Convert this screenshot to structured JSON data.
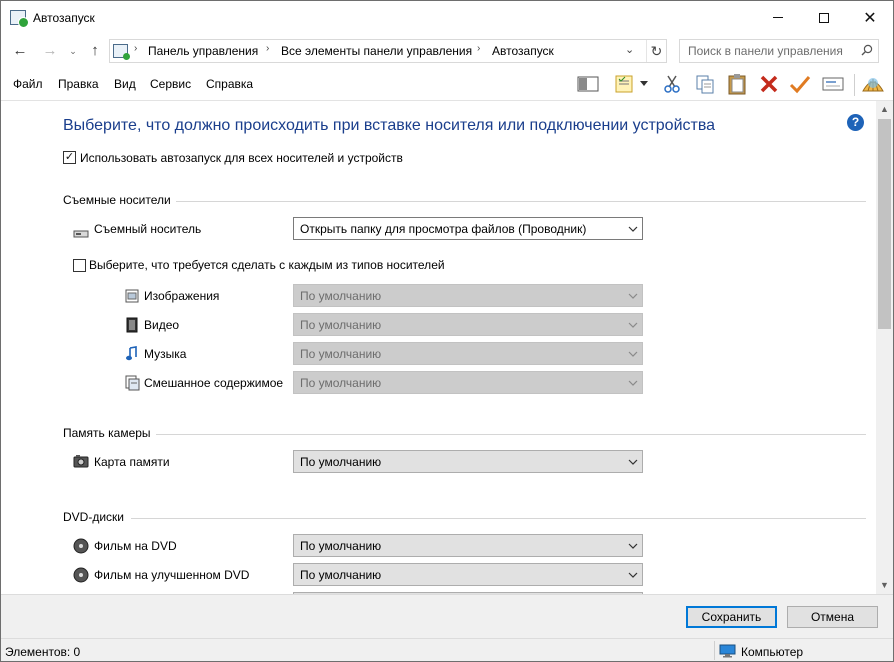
{
  "window": {
    "title": "Автозапуск",
    "close_glyph": "✕"
  },
  "navigation": {
    "back_glyph": "←",
    "forward_glyph": "→",
    "recent_glyph": "⌄",
    "up_glyph": "↑",
    "breadcrumbs": [
      "Панель управления",
      "Все элементы панели управления",
      "Автозапуск"
    ],
    "separator_glyph": "›",
    "dropdown_glyph": "⌄",
    "refresh_glyph": "↻",
    "search_placeholder": "Поиск в панели управления"
  },
  "menu": [
    "Файл",
    "Правка",
    "Вид",
    "Сервис",
    "Справка"
  ],
  "toolbar_icons": [
    "layout-pane-icon",
    "properties-icon",
    "cut-icon",
    "copy-icon",
    "paste-icon",
    "delete-icon",
    "apply-icon",
    "rename-icon",
    "shell-icon"
  ],
  "help_glyph": "?",
  "main": {
    "heading": "Выберите, что должно происходить при вставке носителя или подключении устройства",
    "use_autoplay_checkbox": {
      "label": "Использовать автозапуск для всех носителей и устройств",
      "checked": true,
      "mark": "✓"
    },
    "removable_section": {
      "title": "Съемные носители",
      "removable_label": "Съемный носитель",
      "removable_value": "Открыть папку для просмотра файлов (Проводник)",
      "per_type_checkbox": {
        "label": "Выберите, что требуется сделать с каждым из типов носителей",
        "checked": false
      },
      "media_types": [
        {
          "label": "Изображения",
          "value": "По умолчанию",
          "icon": "pictures-icon"
        },
        {
          "label": "Видео",
          "value": "По умолчанию",
          "icon": "video-icon"
        },
        {
          "label": "Музыка",
          "value": "По умолчанию",
          "icon": "music-icon"
        },
        {
          "label": "Смешанное содержимое",
          "value": "По умолчанию",
          "icon": "mixed-content-icon"
        }
      ]
    },
    "camera_section": {
      "title": "Память камеры",
      "memory_card_label": "Карта памяти",
      "memory_card_value": "По умолчанию"
    },
    "dvd_section": {
      "title": "DVD-диски",
      "items": [
        {
          "label": "Фильм на DVD",
          "value": "По умолчанию"
        },
        {
          "label": "Фильм на улучшенном DVD",
          "value": "По умолчанию"
        }
      ]
    }
  },
  "scrollbar": {
    "up_glyph": "▲",
    "down_glyph": "▼",
    "position": 0.0
  },
  "footer": {
    "save_label": "Сохранить",
    "cancel_label": "Отмена"
  },
  "status": {
    "items_text": "Элементов: 0",
    "location_text": "Компьютер"
  },
  "colors": {
    "heading": "#1a3e8c",
    "accent": "#0078d7",
    "help": "#1e63b8",
    "delete": "#c42b1c",
    "apply": "#e07b22"
  }
}
